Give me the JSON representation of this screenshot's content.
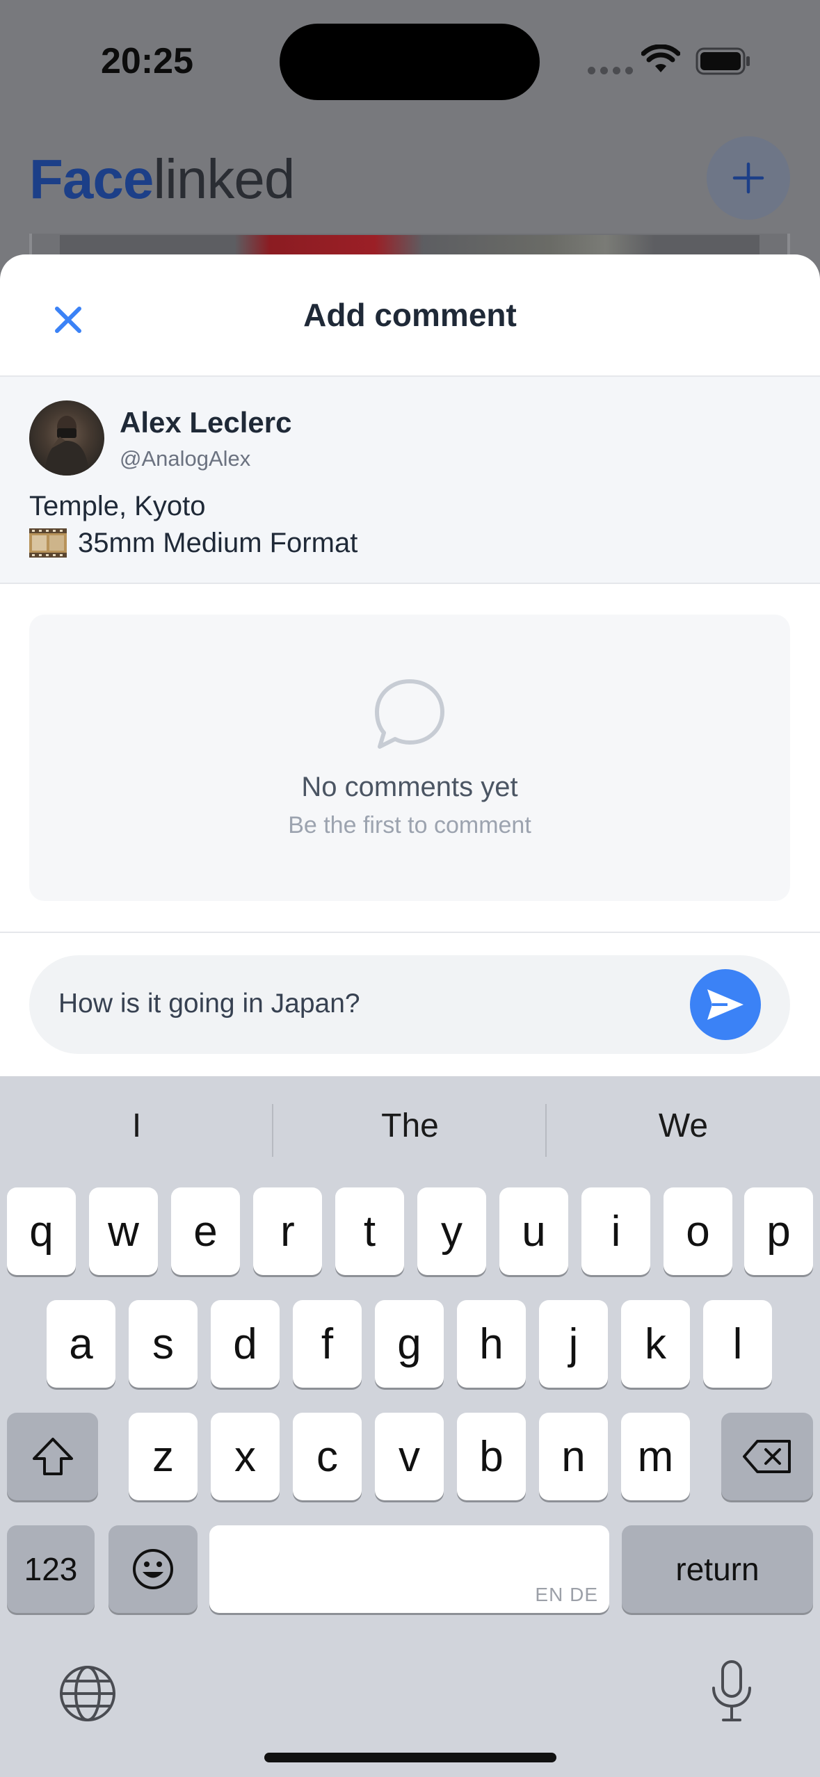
{
  "status_bar": {
    "time": "20:25"
  },
  "background_app": {
    "brand_bold": "Face",
    "brand_regular": "linked"
  },
  "sheet": {
    "title": "Add comment",
    "post": {
      "author_name": "Alex Leclerc",
      "author_handle": "@AnalogAlex",
      "location": "Temple, Kyoto",
      "film_format": "35mm Medium Format"
    },
    "empty_state": {
      "title": "No comments yet",
      "subtitle": "Be the first to comment"
    },
    "comment_input": {
      "value": "How is it going in Japan?"
    }
  },
  "keyboard": {
    "suggestions": [
      "I",
      "The",
      "We"
    ],
    "row1": [
      "q",
      "w",
      "e",
      "r",
      "t",
      "y",
      "u",
      "i",
      "o",
      "p"
    ],
    "row2": [
      "a",
      "s",
      "d",
      "f",
      "g",
      "h",
      "j",
      "k",
      "l"
    ],
    "row3": [
      "z",
      "x",
      "c",
      "v",
      "b",
      "n",
      "m"
    ],
    "numbers_key": "123",
    "return_key": "return",
    "space_languages": "EN DE"
  },
  "colors": {
    "accent": "#3b82f6",
    "brand_dark": "#1c3f88",
    "keyboard_bg": "#d1d4db"
  }
}
